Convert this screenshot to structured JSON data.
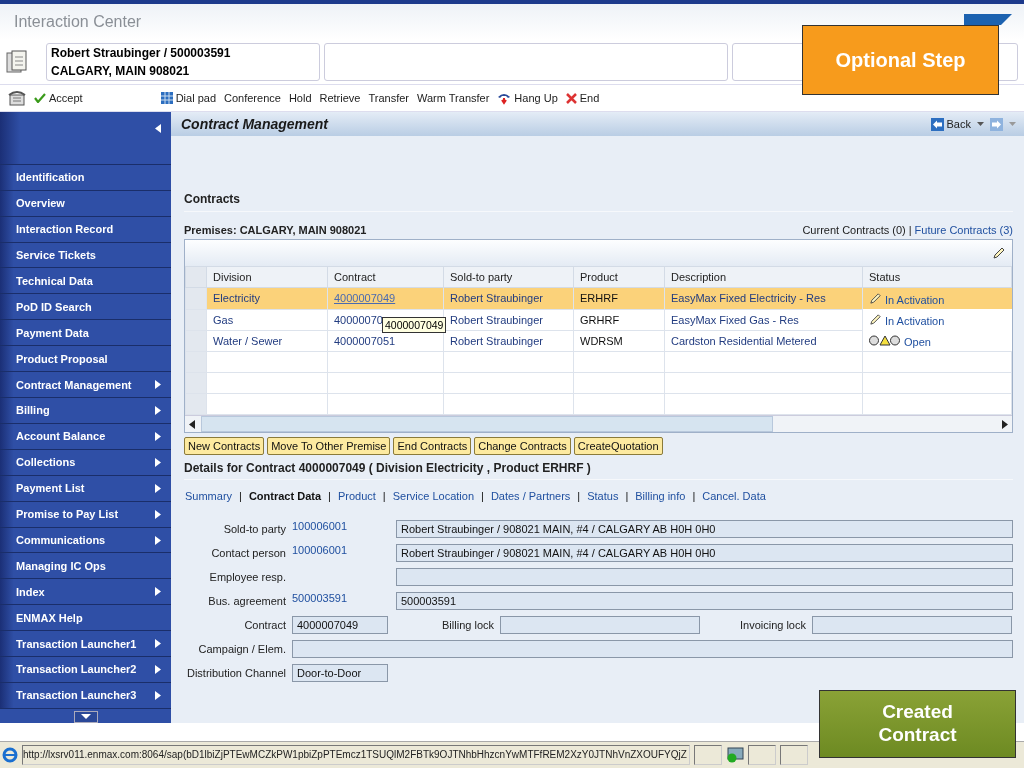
{
  "window": {
    "title": "Interaction Center"
  },
  "overlays": [
    {
      "kind": "orange",
      "text": "Optional Step"
    },
    {
      "kind": "green",
      "text": "Created Contract"
    }
  ],
  "info_boxes": [
    {
      "line1": "Robert Straubinger / 500003591",
      "line2": "CALGARY, MAIN 908021"
    }
  ],
  "toolbar": [
    {
      "kind": "check",
      "label": "Accept"
    },
    {
      "kind": "spacer"
    },
    {
      "kind": "grid",
      "label": "Dial pad"
    },
    {
      "kind": "plain",
      "label": "Conference"
    },
    {
      "kind": "plain",
      "label": "Hold"
    },
    {
      "kind": "plain",
      "label": "Retrieve"
    },
    {
      "kind": "plain",
      "label": "Transfer"
    },
    {
      "kind": "plain",
      "label": "Warm Transfer"
    },
    {
      "kind": "phone",
      "label": "Hang Up"
    },
    {
      "kind": "cross",
      "label": "End"
    }
  ],
  "sidebar": {
    "items": [
      {
        "label": "Identification",
        "submenu": false
      },
      {
        "label": "Overview",
        "submenu": false
      },
      {
        "label": "Interaction Record",
        "submenu": false
      },
      {
        "label": "Service Tickets",
        "submenu": false
      },
      {
        "label": "Technical Data",
        "submenu": false
      },
      {
        "label": "PoD ID Search",
        "submenu": false
      },
      {
        "label": "Payment Data",
        "submenu": false
      },
      {
        "label": "Product Proposal",
        "submenu": false
      },
      {
        "label": "Contract Management",
        "submenu": true
      },
      {
        "label": "Billing",
        "submenu": true
      },
      {
        "label": "Account Balance",
        "submenu": true
      },
      {
        "label": "Collections",
        "submenu": true
      },
      {
        "label": "Payment List",
        "submenu": true
      },
      {
        "label": "Promise to Pay List",
        "submenu": true
      },
      {
        "label": "Communications",
        "submenu": true
      },
      {
        "label": "Managing IC Ops",
        "submenu": false
      },
      {
        "label": "Index",
        "submenu": true
      },
      {
        "label": "ENMAX Help",
        "submenu": false
      },
      {
        "label": "Transaction Launcher1",
        "submenu": true
      },
      {
        "label": "Transaction Launcher2",
        "submenu": true
      },
      {
        "label": "Transaction Launcher3",
        "submenu": true
      }
    ]
  },
  "page": {
    "title": "Contract Management",
    "back": "Back"
  },
  "contracts": {
    "heading": "Contracts",
    "premises": "Premises: CALGARY, MAIN 908021",
    "current": "Current Contracts (0)",
    "separator": "|",
    "future": "Future Contracts (3)",
    "columns": [
      "Division",
      "Contract",
      "Sold-to party",
      "Product",
      "Description",
      "Status"
    ],
    "rows": [
      {
        "selected": true,
        "division": "Electricity",
        "contract": "4000007049",
        "party": "Robert Straubinger",
        "product": "ERHRF",
        "description": "EasyMax Fixed Electricity - Res",
        "kind": "pencil",
        "status": "In Activation"
      },
      {
        "selected": false,
        "division": "Gas",
        "contract": "40000070",
        "party": "Robert Straubinger",
        "product": "GRHRF",
        "description": "EasyMax Fixed Gas - Res",
        "kind": "pencil",
        "status": "In Activation"
      },
      {
        "selected": false,
        "division": "Water / Sewer",
        "contract": "4000007051",
        "party": "Robert Straubinger",
        "product": "WDRSM",
        "description": "Cardston Residential Metered",
        "kind": "lights",
        "status": "Open"
      }
    ],
    "tooltip": "4000007049",
    "buttons": [
      "New Contracts",
      "Move To Other Premise",
      "End Contracts",
      "Change Contracts",
      "CreateQuotation"
    ]
  },
  "details": {
    "heading": "Details for Contract 4000007049 ( Division Electricity , Product ERHRF )",
    "tabs": [
      {
        "label": "Summary",
        "selected": false
      },
      {
        "label": "Contract Data",
        "selected": true
      },
      {
        "label": "Product",
        "selected": false
      },
      {
        "label": "Service Location",
        "selected": false
      },
      {
        "label": "Dates / Partners",
        "selected": false
      },
      {
        "label": "Status",
        "selected": false
      },
      {
        "label": "Billing info",
        "selected": false
      },
      {
        "label": "Cancel. Data",
        "selected": false
      }
    ],
    "tab_separator": "|",
    "wide_fields": [
      {
        "label": "Sold-to party",
        "link": "100006001",
        "value": "Robert Straubinger / 908021 MAIN, #4 / CALGARY AB H0H 0H0"
      },
      {
        "label": "Contact person",
        "link": "100006001",
        "value": "Robert Straubinger / 908021 MAIN, #4 / CALGARY AB H0H 0H0"
      },
      {
        "label": "Employee resp."
      },
      {
        "label": "Bus. agreement",
        "link": "500003591",
        "value": "500003591"
      }
    ],
    "contract_row": [
      {
        "label": "Contract",
        "value": "4000007049"
      },
      {
        "label": "Billing lock"
      },
      {
        "label": "Invoicing lock"
      }
    ],
    "campaign": {
      "label": "Campaign / Elem."
    },
    "channel": {
      "label": "Distribution Channel",
      "value": "Door-to-Door"
    }
  },
  "status_bar": {
    "url": "http://lxsrv011.enmax.com:8064/sap(bD1lbiZjPTEwMCZkPW1pbiZpPTEmcz1TSUQlM2FBTk9OJTNhbHhzcnYwMTFfREM2XzY0JTNhVnZXOUFYQjZ"
  }
}
